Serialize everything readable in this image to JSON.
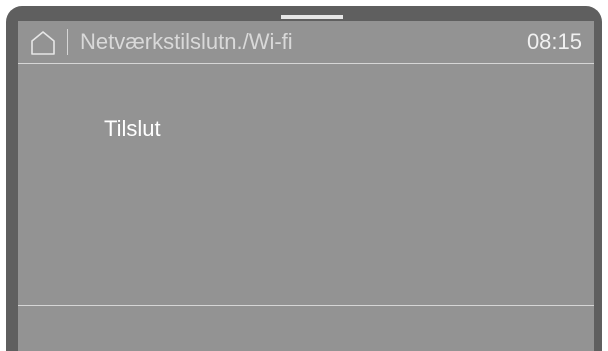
{
  "header": {
    "title": "Netværkstilslutn./Wi-fi",
    "time": "08:15"
  },
  "menu": {
    "items": [
      {
        "label": "Tilslut"
      }
    ]
  },
  "colors": {
    "screen_bg": "#939393",
    "frame": "#5f5f5f",
    "header_text": "#d9d9d9",
    "item_text": "#ffffff"
  }
}
